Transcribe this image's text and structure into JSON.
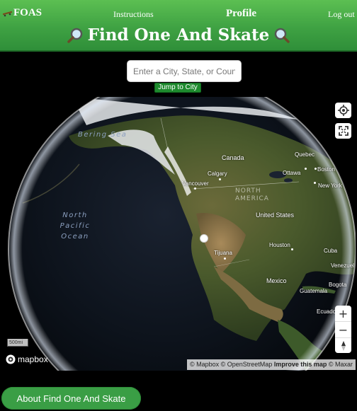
{
  "nav": {
    "brand": "FOAS",
    "instructions": "Instructions",
    "profile": "Profile",
    "logout": "Log out"
  },
  "title": "Find One And Skate",
  "search": {
    "placeholder": "Enter a City, State, or Country",
    "value": "",
    "button_label": "Jump to City"
  },
  "map": {
    "labels": {
      "bering_sea": "Bering Sea",
      "north_pacific": "North Pacific Ocean",
      "north_america": "NORTH AMERICA",
      "canada": "Canada",
      "quebec": "Quebec",
      "boston": "Boston",
      "ottawa": "Ottawa",
      "calgary": "Calgary",
      "vancouver": "Vancouver",
      "new_york": "New York",
      "united_states": "United States",
      "houston": "Houston",
      "tijuana": "Tijuana",
      "cuba": "Cuba",
      "venezuela": "Venezuel",
      "mexico": "Mexico",
      "bogota": "Bogota",
      "guatemala": "Guatemala",
      "ecuador": "Ecuado"
    },
    "scale": "500mi",
    "logo": "mapbox",
    "attribution": {
      "mapbox": "© Mapbox",
      "osm": "© OpenStreetMap",
      "improve": "Improve this map",
      "maxar": "© Maxar"
    },
    "controls": {
      "zoom_in": "+",
      "zoom_out": "−"
    },
    "icons": [
      "geolocate-icon",
      "fullscreen-icon",
      "compass-icon"
    ]
  },
  "footer": {
    "about_label": "About Find One And Skate"
  },
  "colors": {
    "header_green": "#3fa243",
    "button_green": "#1e8a2e",
    "about_green": "#3a9e45"
  }
}
